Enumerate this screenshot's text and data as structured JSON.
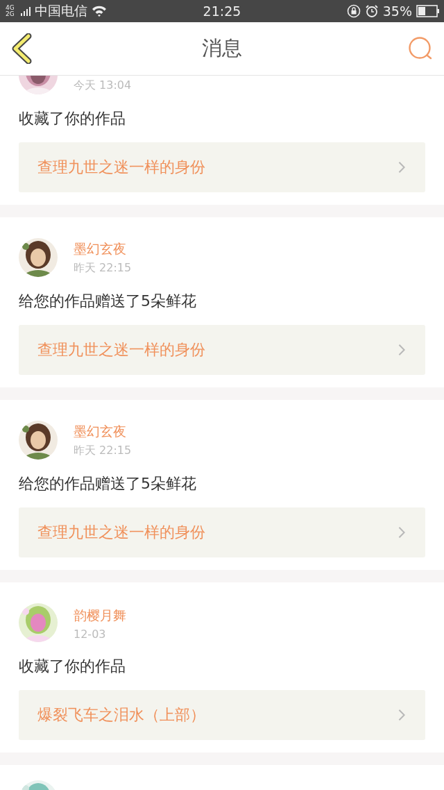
{
  "status_bar": {
    "network": "4G 2G",
    "carrier": "中国电信",
    "time": "21:25",
    "battery": "35%"
  },
  "header": {
    "title": "消息"
  },
  "messages": [
    {
      "time": "今天 13:04",
      "text": "收藏了你的作品",
      "work": "查理九世之迷一样的身份",
      "avatar": {
        "kind": "picture"
      }
    },
    {
      "name": "墨幻玄夜",
      "time": "昨天 22:15",
      "text": "给您的作品赠送了5朵鲜花",
      "work": "查理九世之迷一样的身份",
      "avatar": {
        "kind": "picture"
      }
    },
    {
      "name": "墨幻玄夜",
      "time": "昨天 22:15",
      "text": "给您的作品赠送了5朵鲜花",
      "work": "查理九世之迷一样的身份",
      "avatar": {
        "kind": "picture"
      }
    },
    {
      "name": "韵樱月舞",
      "time": "12-03",
      "text": "收藏了你的作品",
      "work": "爆裂飞车之泪水（上部）",
      "avatar": {
        "kind": "picture"
      }
    },
    {
      "avatar": {
        "kind": "picture"
      }
    }
  ]
}
